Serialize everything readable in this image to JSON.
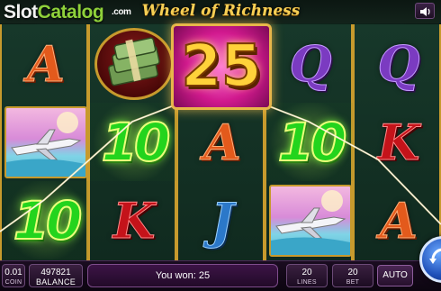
{
  "header": {
    "brand_slot": "Slot",
    "brand_catalog": "Catalog",
    "brand_com": ".com",
    "game_title": "Wheel of Richness",
    "sound_icon": "speaker-icon"
  },
  "reels": [
    [
      "A",
      "jet",
      "10"
    ],
    [
      "cash",
      "10",
      "K"
    ],
    [
      "",
      "A",
      "J"
    ],
    [
      "Q",
      "10",
      "jet"
    ],
    [
      "Q",
      "K",
      "A"
    ]
  ],
  "big_win_value": "25",
  "bottom": {
    "coin_value": "0.01",
    "coin_label": "COIN",
    "balance_value": "497821",
    "balance_label": "BALANCE",
    "win_message": "You won: 25",
    "lines_value": "20",
    "lines_label": "LINES",
    "bet_value": "20",
    "bet_label": "BET",
    "auto_label": "AUTO",
    "spin_icon": "spin-icon"
  },
  "colors": {
    "frame_gold": "#c79a2d",
    "ten_green": "#23d41d",
    "win_pink": "#d1198e"
  }
}
